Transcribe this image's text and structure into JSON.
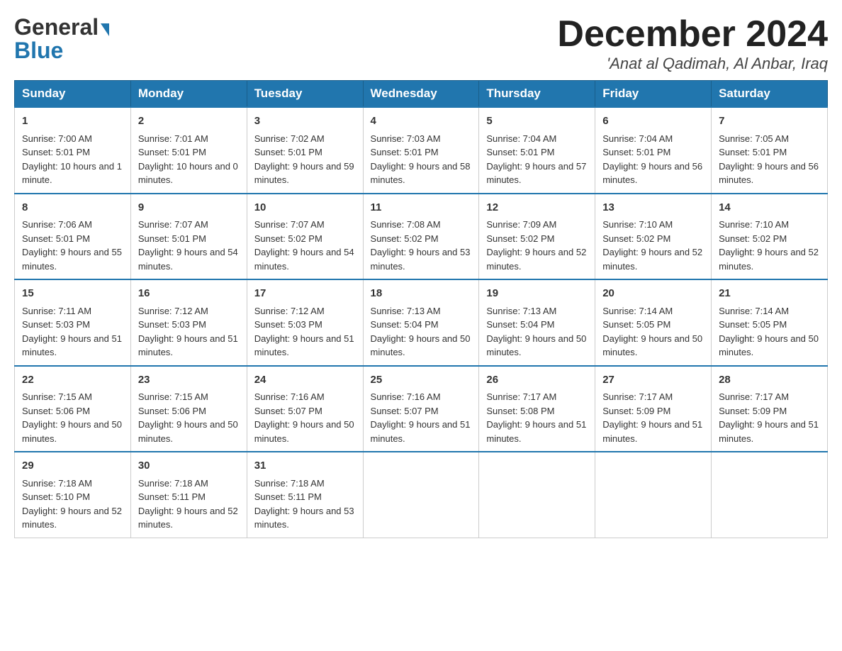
{
  "header": {
    "logo_general": "General",
    "logo_blue": "Blue",
    "month_title": "December 2024",
    "subtitle": "'Anat al Qadimah, Al Anbar, Iraq"
  },
  "weekdays": [
    "Sunday",
    "Monday",
    "Tuesday",
    "Wednesday",
    "Thursday",
    "Friday",
    "Saturday"
  ],
  "weeks": [
    [
      {
        "day": "1",
        "sunrise": "7:00 AM",
        "sunset": "5:01 PM",
        "daylight": "10 hours and 1 minute."
      },
      {
        "day": "2",
        "sunrise": "7:01 AM",
        "sunset": "5:01 PM",
        "daylight": "10 hours and 0 minutes."
      },
      {
        "day": "3",
        "sunrise": "7:02 AM",
        "sunset": "5:01 PM",
        "daylight": "9 hours and 59 minutes."
      },
      {
        "day": "4",
        "sunrise": "7:03 AM",
        "sunset": "5:01 PM",
        "daylight": "9 hours and 58 minutes."
      },
      {
        "day": "5",
        "sunrise": "7:04 AM",
        "sunset": "5:01 PM",
        "daylight": "9 hours and 57 minutes."
      },
      {
        "day": "6",
        "sunrise": "7:04 AM",
        "sunset": "5:01 PM",
        "daylight": "9 hours and 56 minutes."
      },
      {
        "day": "7",
        "sunrise": "7:05 AM",
        "sunset": "5:01 PM",
        "daylight": "9 hours and 56 minutes."
      }
    ],
    [
      {
        "day": "8",
        "sunrise": "7:06 AM",
        "sunset": "5:01 PM",
        "daylight": "9 hours and 55 minutes."
      },
      {
        "day": "9",
        "sunrise": "7:07 AM",
        "sunset": "5:01 PM",
        "daylight": "9 hours and 54 minutes."
      },
      {
        "day": "10",
        "sunrise": "7:07 AM",
        "sunset": "5:02 PM",
        "daylight": "9 hours and 54 minutes."
      },
      {
        "day": "11",
        "sunrise": "7:08 AM",
        "sunset": "5:02 PM",
        "daylight": "9 hours and 53 minutes."
      },
      {
        "day": "12",
        "sunrise": "7:09 AM",
        "sunset": "5:02 PM",
        "daylight": "9 hours and 52 minutes."
      },
      {
        "day": "13",
        "sunrise": "7:10 AM",
        "sunset": "5:02 PM",
        "daylight": "9 hours and 52 minutes."
      },
      {
        "day": "14",
        "sunrise": "7:10 AM",
        "sunset": "5:02 PM",
        "daylight": "9 hours and 52 minutes."
      }
    ],
    [
      {
        "day": "15",
        "sunrise": "7:11 AM",
        "sunset": "5:03 PM",
        "daylight": "9 hours and 51 minutes."
      },
      {
        "day": "16",
        "sunrise": "7:12 AM",
        "sunset": "5:03 PM",
        "daylight": "9 hours and 51 minutes."
      },
      {
        "day": "17",
        "sunrise": "7:12 AM",
        "sunset": "5:03 PM",
        "daylight": "9 hours and 51 minutes."
      },
      {
        "day": "18",
        "sunrise": "7:13 AM",
        "sunset": "5:04 PM",
        "daylight": "9 hours and 50 minutes."
      },
      {
        "day": "19",
        "sunrise": "7:13 AM",
        "sunset": "5:04 PM",
        "daylight": "9 hours and 50 minutes."
      },
      {
        "day": "20",
        "sunrise": "7:14 AM",
        "sunset": "5:05 PM",
        "daylight": "9 hours and 50 minutes."
      },
      {
        "day": "21",
        "sunrise": "7:14 AM",
        "sunset": "5:05 PM",
        "daylight": "9 hours and 50 minutes."
      }
    ],
    [
      {
        "day": "22",
        "sunrise": "7:15 AM",
        "sunset": "5:06 PM",
        "daylight": "9 hours and 50 minutes."
      },
      {
        "day": "23",
        "sunrise": "7:15 AM",
        "sunset": "5:06 PM",
        "daylight": "9 hours and 50 minutes."
      },
      {
        "day": "24",
        "sunrise": "7:16 AM",
        "sunset": "5:07 PM",
        "daylight": "9 hours and 50 minutes."
      },
      {
        "day": "25",
        "sunrise": "7:16 AM",
        "sunset": "5:07 PM",
        "daylight": "9 hours and 51 minutes."
      },
      {
        "day": "26",
        "sunrise": "7:17 AM",
        "sunset": "5:08 PM",
        "daylight": "9 hours and 51 minutes."
      },
      {
        "day": "27",
        "sunrise": "7:17 AM",
        "sunset": "5:09 PM",
        "daylight": "9 hours and 51 minutes."
      },
      {
        "day": "28",
        "sunrise": "7:17 AM",
        "sunset": "5:09 PM",
        "daylight": "9 hours and 51 minutes."
      }
    ],
    [
      {
        "day": "29",
        "sunrise": "7:18 AM",
        "sunset": "5:10 PM",
        "daylight": "9 hours and 52 minutes."
      },
      {
        "day": "30",
        "sunrise": "7:18 AM",
        "sunset": "5:11 PM",
        "daylight": "9 hours and 52 minutes."
      },
      {
        "day": "31",
        "sunrise": "7:18 AM",
        "sunset": "5:11 PM",
        "daylight": "9 hours and 53 minutes."
      },
      null,
      null,
      null,
      null
    ]
  ]
}
